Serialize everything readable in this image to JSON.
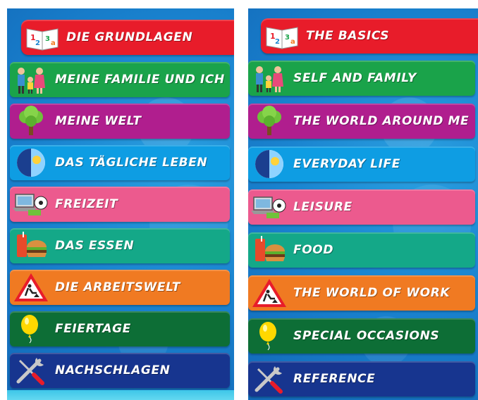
{
  "colors": {
    "header_red": "#e81c2a",
    "green": "#1aa34a",
    "purple": "#b01e8e",
    "sky": "#0e9de3",
    "pink": "#ec5a8e",
    "teal": "#14a888",
    "orange": "#f07a22",
    "dark_green": "#0d6e36",
    "navy": "#17358f"
  },
  "panels": [
    {
      "header": {
        "label": "DIE GRUNDLAGEN",
        "icon": "alphabet-book-icon"
      },
      "items": [
        {
          "label": "MEINE FAMILIE UND ICH",
          "icon": "family-icon"
        },
        {
          "label": "MEINE WELT",
          "icon": "tree-icon"
        },
        {
          "label": "DAS TÄGLICHE LEBEN",
          "icon": "day-night-icon"
        },
        {
          "label": "FREIZEIT",
          "icon": "laptop-ball-icon"
        },
        {
          "label": "DAS ESSEN",
          "icon": "burger-drink-icon"
        },
        {
          "label": "DIE ARBEITSWELT",
          "icon": "roadwork-sign-icon"
        },
        {
          "label": "FEIERTAGE",
          "icon": "balloon-icon"
        },
        {
          "label": "NACHSCHLAGEN",
          "icon": "tools-icon"
        }
      ]
    },
    {
      "header": {
        "label": "THE BASICS",
        "icon": "alphabet-book-icon"
      },
      "items": [
        {
          "label": "SELF AND FAMILY",
          "icon": "family-icon"
        },
        {
          "label": "THE WORLD AROUND ME",
          "icon": "tree-icon"
        },
        {
          "label": "EVERYDAY LIFE",
          "icon": "day-night-icon"
        },
        {
          "label": "LEISURE",
          "icon": "laptop-ball-icon"
        },
        {
          "label": "FOOD",
          "icon": "burger-drink-icon"
        },
        {
          "label": "THE WORLD OF WORK",
          "icon": "roadwork-sign-icon"
        },
        {
          "label": "SPECIAL OCCASIONS",
          "icon": "balloon-icon"
        },
        {
          "label": "REFERENCE",
          "icon": "tools-icon"
        }
      ]
    }
  ]
}
